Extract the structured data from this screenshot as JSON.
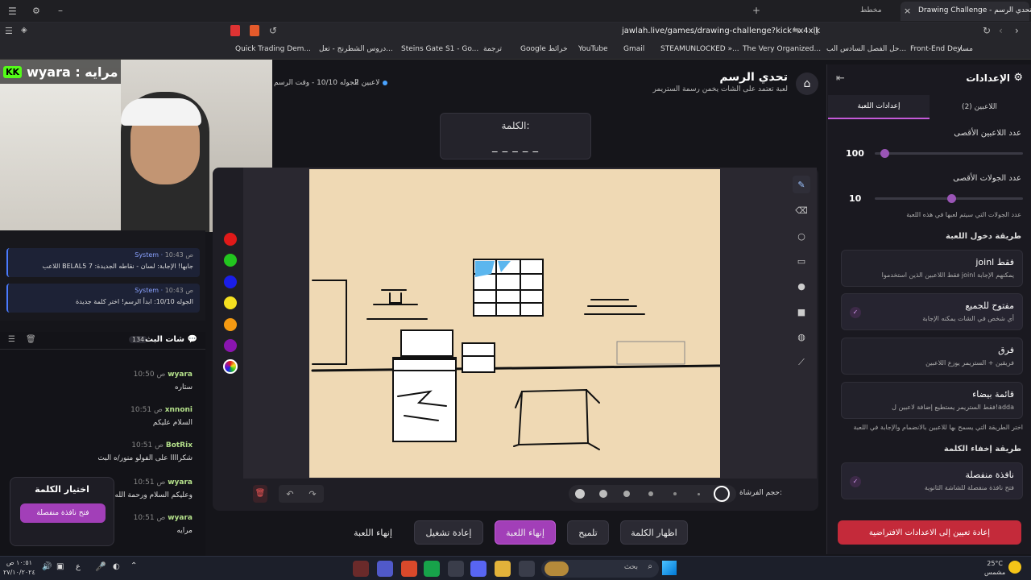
{
  "browser": {
    "tab_title": "Drawing Challenge - تحدي الرسم",
    "tab2_label": "مخطط",
    "url": "jawlah.live/games/drawing-challenge?kick=x4xik",
    "bookmarks": [
      "Quick Trading Dem...",
      "دروس الشطرنج - تعل...",
      "Steins Gate S1 - Go...",
      "ترجمة",
      "Google خرائط",
      "YouTube",
      "Gmail",
      "STEAMUNLOCKED »...",
      "The Very Organized...",
      "حل الفصل السادس الب...",
      "Front-End Dev...",
      "مسار"
    ]
  },
  "overlay": {
    "streamer_name": "wyara : مرايه"
  },
  "header": {
    "title": "تحدي الرسم",
    "subtitle": "لعبة تعتمد على الشات يخمن رسمة الستريمر",
    "status": "لاعبين 2",
    "round_info": "الجوله 10/10 - وقت الرسم",
    "word_label": "الكلمة:",
    "word_mask": "_ _ _ _ _"
  },
  "brush": {
    "label": "حجم الفرشاة:"
  },
  "colors": [
    "#e01919",
    "#22c51f",
    "#1a1ee8",
    "#f5e020",
    "#f59a12",
    "#8a15b0"
  ],
  "actions": {
    "end_game": "إنهاء اللعبة",
    "restart": "إعادة تشغيل",
    "end_game_primary": "إنهاء اللعبة",
    "hint": "تلميح",
    "show_word": "اظهار الكلمة"
  },
  "chat_top": [
    {
      "who": "System",
      "time": "10:43 ص",
      "text": "اللاعب BELAL5 جابها! الإجابة: لسان - نقاطه الجديدة: 7"
    },
    {
      "who": "System",
      "time": "10:43 ص",
      "text": "الجوله 10/10: ابدأ الرسم! اختر كلمة جديدة"
    }
  ],
  "chat": {
    "title": "شات البث",
    "count": "134",
    "messages": [
      {
        "who": "wyara",
        "time": "10:50 ص",
        "text": "ستاره"
      },
      {
        "who": "xnnoni",
        "time": "10:51 ص",
        "text": "السلام عليكم"
      },
      {
        "who": "BotRix",
        "time": "10:51 ص",
        "text": "شكراااا على الفولو منور/ه البث"
      },
      {
        "who": "wyara",
        "time": "10:51 ص",
        "text": "وعليكم السلام ورحمة الله"
      },
      {
        "who": "wyara",
        "time": "10:51 ص",
        "text": "مرايه"
      }
    ]
  },
  "word_popup": {
    "title": "اختيار الكلمة",
    "button": "فتح نافذة منفصلة"
  },
  "settings": {
    "title": "الإعدادات",
    "tab_game": "إعدادات اللعبة",
    "tab_players": "اللاعبين (2)",
    "max_players_label": "عدد اللاعبين الأقصى",
    "max_players_value": "100",
    "max_rounds_label": "عدد الجولات الأقصى",
    "max_rounds_value": "10",
    "max_rounds_help": "عدد الجولات التي سيتم لعبها في هذه اللعبة",
    "join_method_label": "طريقة دخول اللعبة",
    "join_options": [
      {
        "title": "joinl فقط",
        "desc": "فقط اللاعبين الذين استخدموا joinl يمكنهم الإجابة",
        "checked": false
      },
      {
        "title": "مفتوح للجميع",
        "desc": "أي شخص في الشات يمكنه الإجابة",
        "checked": true
      },
      {
        "title": "فرق",
        "desc": "فريقين + الستريمر يوزع اللاعبين",
        "checked": false
      },
      {
        "title": "قائمة بيضاء",
        "desc": "فقط الستريمر يستطيع إضافة لاعبين ل!adda",
        "checked": false
      }
    ],
    "join_help": "اختر الطريقة التي يسمح بها للاعبين بالانضمام والإجابة في اللعبة",
    "hide_word_label": "طريقة إخفاء الكلمة",
    "hide_option": {
      "title": "نافذة منفصلة",
      "desc": "فتح نافذة منفصلة للشاشة الثانوية",
      "checked": true
    },
    "reset_button": "إعادة تعيين إلى الاعدادات الافتراضية",
    "sliders": {
      "players_fraction": 0.04,
      "rounds_fraction": 0.52
    }
  },
  "taskbar": {
    "search_placeholder": "بحث",
    "weather_temp": "25°C",
    "weather_desc": "مشمس",
    "clock_time": "١٠:٥١ ص",
    "clock_date": "٢٧/١٠/٢٠٢٤"
  }
}
